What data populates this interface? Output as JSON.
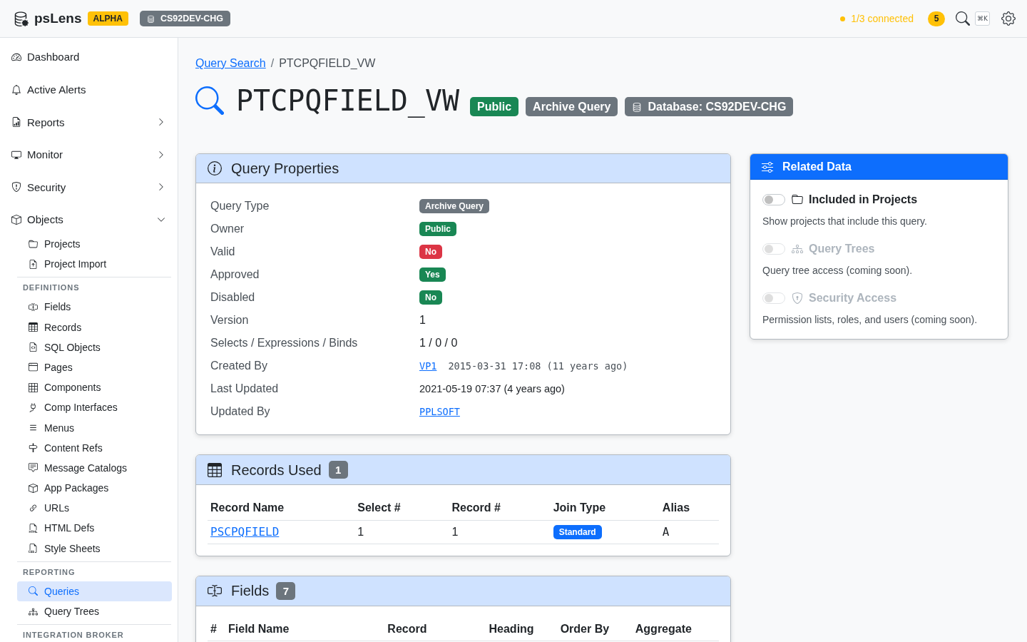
{
  "topbar": {
    "app_name": "psLens",
    "stage_badge": "ALPHA",
    "database": "CS92DEV-CHG",
    "connection": {
      "text": "1/3 connected",
      "color": "#ffc107"
    },
    "alert_count": "5",
    "shortcut": "⌘K"
  },
  "sidebar": {
    "items": [
      {
        "label": "Dashboard",
        "selected": false
      },
      {
        "label": "Active Alerts",
        "selected": false
      },
      {
        "label": "Reports",
        "selected": false,
        "expanded": false
      },
      {
        "label": "Monitor",
        "selected": false,
        "expanded": false
      },
      {
        "label": "Security",
        "selected": false,
        "expanded": false
      },
      {
        "label": "Objects",
        "selected": false,
        "expanded": true,
        "children": [
          {
            "label": "Projects",
            "selected": false
          },
          {
            "label": "Project Import",
            "selected": false
          }
        ],
        "sections": [
          {
            "heading": "DEFINITIONS",
            "items": [
              {
                "label": "Fields",
                "selected": false
              },
              {
                "label": "Records",
                "selected": false
              },
              {
                "label": "SQL Objects",
                "selected": false
              },
              {
                "label": "Pages",
                "selected": false
              },
              {
                "label": "Components",
                "selected": false
              },
              {
                "label": "Comp Interfaces",
                "selected": false
              },
              {
                "label": "Menus",
                "selected": false
              },
              {
                "label": "Content Refs",
                "selected": false
              },
              {
                "label": "Message Catalogs",
                "selected": false
              },
              {
                "label": "App Packages",
                "selected": false
              },
              {
                "label": "URLs",
                "selected": false
              },
              {
                "label": "HTML Defs",
                "selected": false
              },
              {
                "label": "Style Sheets",
                "selected": false
              }
            ]
          },
          {
            "heading": "REPORTING",
            "items": [
              {
                "label": "Queries",
                "selected": true
              },
              {
                "label": "Query Trees",
                "selected": false
              }
            ]
          },
          {
            "heading": "INTEGRATION BROKER"
          }
        ]
      }
    ]
  },
  "breadcrumb": {
    "separator": "/",
    "items": [
      {
        "label": "Query Search",
        "kind": "link"
      },
      {
        "label": "PTCPQFIELD_VW",
        "kind": "current"
      }
    ]
  },
  "page_header": {
    "title": "PTCPQFIELD_VW",
    "badges": [
      {
        "text": "Public",
        "color": "#198754",
        "kind": "plain"
      },
      {
        "text": "Archive Query",
        "color": "#6c757d",
        "kind": "plain"
      },
      {
        "text": "Database: CS92DEV-CHG",
        "color": "#6c757d",
        "kind": "database"
      }
    ]
  },
  "query_properties": {
    "title": "Query Properties",
    "rows": [
      {
        "label": "Query Type",
        "kind": "badge",
        "value": "Archive Query",
        "color": "#6c757d"
      },
      {
        "label": "Owner",
        "kind": "badge",
        "value": "Public",
        "color": "#198754"
      },
      {
        "label": "Valid",
        "kind": "badge",
        "value": "No",
        "color": "#dc3545"
      },
      {
        "label": "Approved",
        "kind": "badge",
        "value": "Yes",
        "color": "#198754"
      },
      {
        "label": "Disabled",
        "kind": "badge",
        "value": "No",
        "color": "#198754"
      },
      {
        "label": "Version",
        "kind": "text",
        "value": "1"
      },
      {
        "label": "Selects / Expressions / Binds",
        "kind": "text",
        "value": "1 / 0 / 0"
      },
      {
        "label": "Created By",
        "kind": "user_datetime",
        "value": "VP1",
        "detail": "2015-03-31 17:08 (11 years ago)"
      },
      {
        "label": "Last Updated",
        "kind": "datetime",
        "value": "2021-05-19 07:37 (4 years ago)"
      },
      {
        "label": "Updated By",
        "kind": "user",
        "value": "PPLSOFT"
      }
    ]
  },
  "related_data": {
    "title": "Related Data",
    "toggles": [
      {
        "label": "Included in Projects",
        "description": "Show projects that include this query.",
        "on": false,
        "disabled": false
      },
      {
        "label": "Query Trees",
        "description": "Query tree access (coming soon).",
        "on": false,
        "disabled": true
      },
      {
        "label": "Security Access",
        "description": "Permission lists, roles, and users (coming soon).",
        "on": false,
        "disabled": true
      }
    ]
  },
  "records_used": {
    "title": "Records Used",
    "count": "1",
    "columns": [
      "Record Name",
      "Select #",
      "Record #",
      "Join Type",
      "Alias"
    ],
    "rows": [
      {
        "record_name": "PSCPQFIELD",
        "select_no": "1",
        "record_no": "1",
        "join_type": "Standard",
        "alias": "A"
      }
    ]
  },
  "fields": {
    "title": "Fields",
    "count": "7",
    "columns": [
      "#",
      "Field Name",
      "Record",
      "Heading",
      "Order By",
      "Aggregate"
    ]
  }
}
